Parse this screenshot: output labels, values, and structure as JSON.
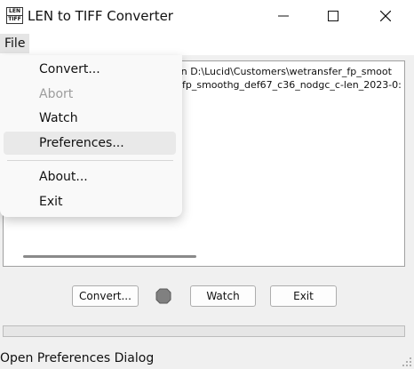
{
  "window": {
    "icon_text_top": "LEN",
    "icon_text_bottom": "TIFF",
    "title": "LEN to TIFF Converter",
    "minimize_glyph": "—",
    "maximize_glyph": "☐",
    "close_glyph": "✕"
  },
  "menubar": {
    "file_label": "File"
  },
  "file_menu": {
    "items": [
      {
        "label": "Convert...",
        "enabled": true
      },
      {
        "label": "Abort",
        "enabled": false
      },
      {
        "label": "Watch",
        "enabled": true
      },
      {
        "label": "Preferences...",
        "enabled": true,
        "highlighted": true
      },
      {
        "label": "About...",
        "enabled": true
      },
      {
        "label": "Exit",
        "enabled": true
      }
    ]
  },
  "log": {
    "lines": [
      "on D:\\Lucid\\Customers\\wetransfer_fp_smoot",
      "fp_smoothg_def67_c36_nodgc_c-len_2023-0:"
    ]
  },
  "buttons": {
    "convert_label": "Convert...",
    "watch_label": "Watch",
    "exit_label": "Exit"
  },
  "indicator": {
    "color": "#808080"
  },
  "status": {
    "text": "Open Preferences Dialog"
  },
  "colors": {
    "menu_highlight": "#e9e9e9",
    "disabled_text": "#9d9d9d"
  }
}
